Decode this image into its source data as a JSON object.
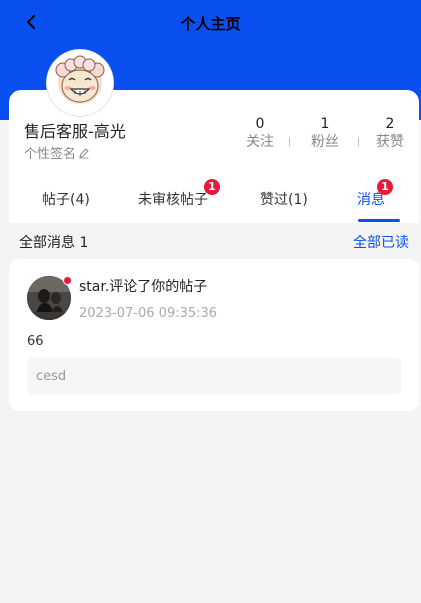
{
  "header": {
    "title": "个人主页",
    "bg_color": "#0a4fef",
    "back_icon": "chevron-left-icon"
  },
  "profile": {
    "avatar_icon": "cartoon-sheep-avatar",
    "name": "售后客服-高光",
    "signature": "个性签名",
    "signature_icon": "pencil-icon",
    "stats": [
      {
        "value": "0",
        "label": "关注"
      },
      {
        "value": "1",
        "label": "粉丝"
      },
      {
        "value": "2",
        "label": "获赞"
      }
    ]
  },
  "tabs": [
    {
      "label": "帖子(4)",
      "badge": ""
    },
    {
      "label": "未审核帖子",
      "badge": "1"
    },
    {
      "label": "赞过(1)",
      "badge": ""
    },
    {
      "label": "消息",
      "badge": "1",
      "active": true
    }
  ],
  "messages_section": {
    "title": "全部消息 1",
    "mark_all_read": "全部已读"
  },
  "messages": [
    {
      "title": "star.评论了你的帖子",
      "time": "2023-07-06 09:35:36",
      "content": "66",
      "quote": "cesd",
      "unread": true
    }
  ],
  "colors": {
    "accent": "#0a4fef",
    "badge": "#e8183a"
  }
}
